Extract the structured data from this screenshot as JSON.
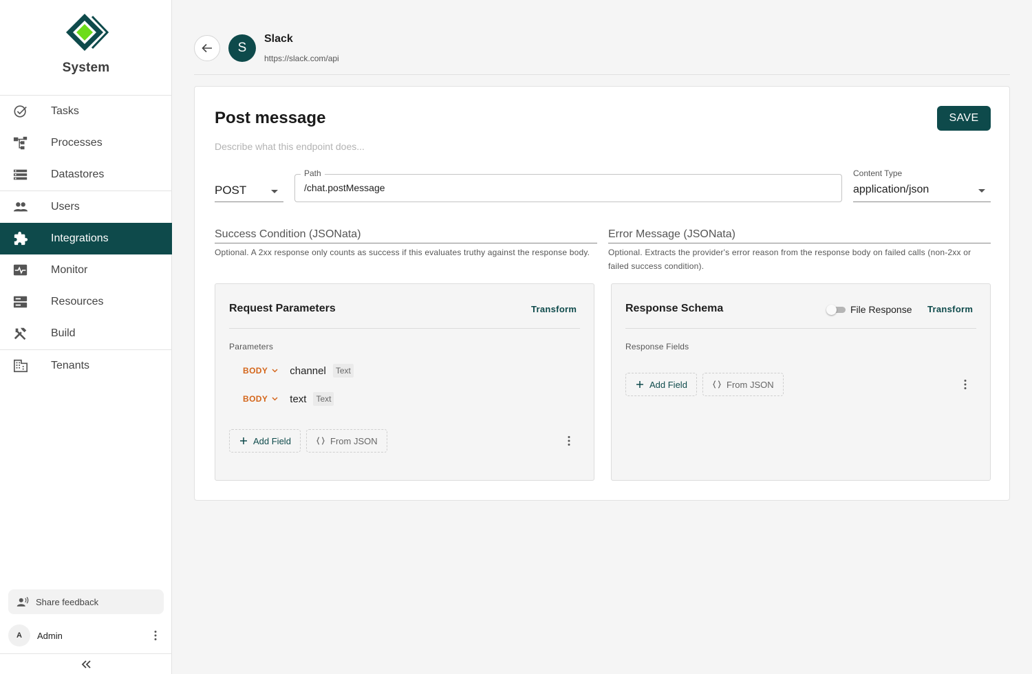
{
  "sidebar": {
    "brand": "System",
    "items": [
      {
        "label": "Tasks",
        "icon": "check-circle-icon"
      },
      {
        "label": "Processes",
        "icon": "processes-icon"
      },
      {
        "label": "Datastores",
        "icon": "datastores-icon"
      },
      {
        "label": "Users",
        "icon": "users-icon"
      },
      {
        "label": "Integrations",
        "icon": "puzzle-icon",
        "active": true
      },
      {
        "label": "Monitor",
        "icon": "monitor-icon"
      },
      {
        "label": "Resources",
        "icon": "resources-icon"
      },
      {
        "label": "Build",
        "icon": "tools-icon"
      },
      {
        "label": "Tenants",
        "icon": "building-icon"
      }
    ],
    "feedback_label": "Share feedback",
    "user": {
      "initial": "A",
      "name": "Admin"
    }
  },
  "integration": {
    "avatar_letter": "S",
    "name": "Slack",
    "url": "https://slack.com/api"
  },
  "endpoint": {
    "title": "Post message",
    "description_placeholder": "Describe what this endpoint does...",
    "save_label": "SAVE",
    "method": "POST",
    "path_label": "Path",
    "path_value": "/chat.postMessage",
    "content_type_label": "Content Type",
    "content_type_value": "application/json",
    "success_condition": {
      "placeholder": "Success Condition (JSONata)",
      "help": "Optional. A 2xx response only counts as success if this evaluates truthy against the response body."
    },
    "error_message": {
      "placeholder": "Error Message (JSONata)",
      "help": "Optional. Extracts the provider's error reason from the response body on failed calls (non-2xx or failed success condition)."
    }
  },
  "request_panel": {
    "title": "Request Parameters",
    "transform_label": "Transform",
    "section_label": "Parameters",
    "params": [
      {
        "location": "BODY",
        "name": "channel",
        "type": "Text"
      },
      {
        "location": "BODY",
        "name": "text",
        "type": "Text"
      }
    ],
    "add_field_label": "Add Field",
    "from_json_label": "From JSON"
  },
  "response_panel": {
    "title": "Response Schema",
    "file_response_label": "File Response",
    "file_response_on": false,
    "transform_label": "Transform",
    "section_label": "Response Fields",
    "add_field_label": "Add Field",
    "from_json_label": "From JSON"
  },
  "colors": {
    "primary": "#0e4a4b",
    "body_tag": "#d4661b",
    "logo_green": "#6ddc1a"
  }
}
